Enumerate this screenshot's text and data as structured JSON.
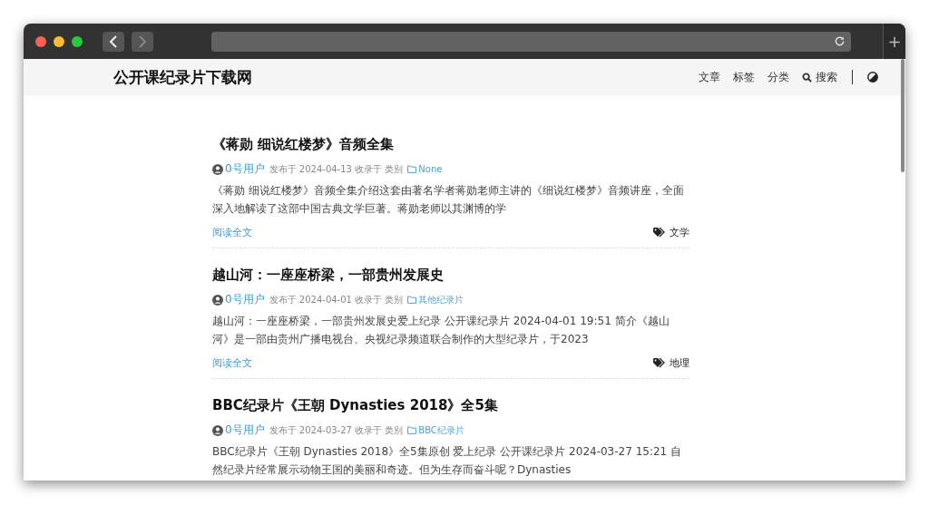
{
  "browser": {
    "back_disabled": false,
    "forward_disabled": true,
    "new_tab": "+"
  },
  "site": {
    "title": "公开课纪录片下载网",
    "nav": [
      {
        "label": "文章",
        "kind": "link"
      },
      {
        "label": "标签",
        "kind": "link"
      },
      {
        "label": "分类",
        "kind": "link"
      },
      {
        "label": "搜索",
        "kind": "search"
      }
    ]
  },
  "posts": [
    {
      "title": "《蒋勋 细说红楼梦》音频全集",
      "author": "0号用户",
      "meta": "发布于 2024-04-13 收录于 类别",
      "category": "None",
      "excerpt": "《蒋勋 细说红楼梦》音频全集介绍这套由著名学者蒋勋老师主讲的《细说红楼梦》音频讲座，全面深入地解读了这部中国古典文学巨著。蒋勋老师以其渊博的学",
      "read_more": "阅读全文",
      "tag": "文学"
    },
    {
      "title": "越山河：一座座桥梁，一部贵州发展史",
      "author": "0号用户",
      "meta": "发布于 2024-04-01 收录于 类别",
      "category": "其他纪录片",
      "excerpt": "越山河：一座座桥梁，一部贵州发展史爱上纪录 公开课纪录片 2024-04-01 19:51 简介《越山河》是一部由贵州广播电视台、央视纪录频道联合制作的大型纪录片，于2023",
      "read_more": "阅读全文",
      "tag": "地理"
    },
    {
      "title": "BBC纪录片《王朝 Dynasties 2018》全5集",
      "author": "0号用户",
      "meta": "发布于 2024-03-27 收录于 类别",
      "category": "BBC纪录片",
      "excerpt": "BBC纪录片《王朝 Dynasties 2018》全5集原创 爱上纪录 公开课纪录片 2024-03-27 15:21 自然纪录片经常展示动物王国的美丽和奇迹。但为生存而奋斗呢？Dynasties"
    }
  ]
}
